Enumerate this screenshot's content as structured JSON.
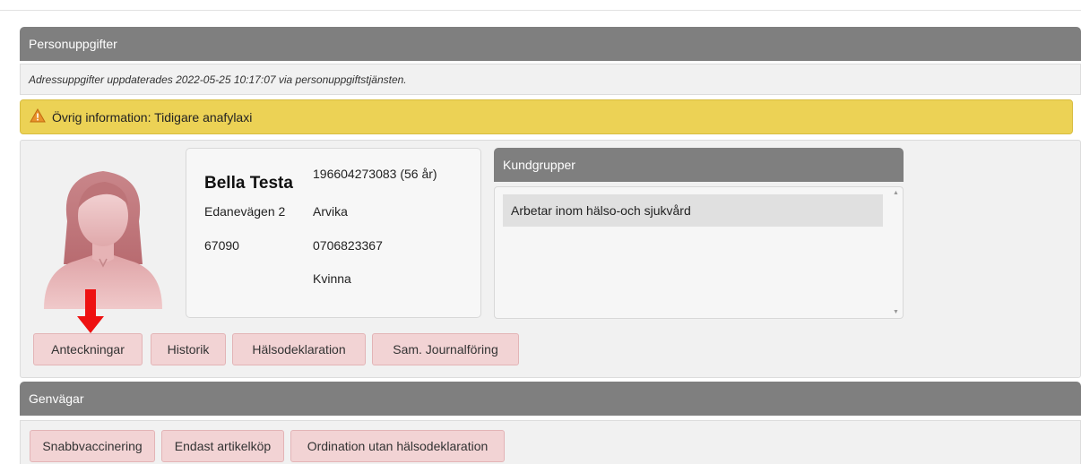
{
  "personal": {
    "section_title": "Personuppgifter",
    "address_note": "Adressuppgifter uppdaterades 2022-05-25 10:17:07 via personuppgiftstjänsten.",
    "warning_icon": "warning-triangle-icon",
    "warning_text": "Övrig information: Tidigare anafylaxi"
  },
  "person": {
    "name": "Bella Testa",
    "personal_number": "196604273083 (56 år)",
    "street": "Edanevägen 2",
    "city": "Arvika",
    "postal_code": "67090",
    "phone": "0706823367",
    "gender": "Kvinna"
  },
  "customer_groups": {
    "title": "Kundgrupper",
    "items": [
      "Arbetar inom hälso-och sjukvård"
    ]
  },
  "action_buttons": {
    "notes": "Anteckningar",
    "history": "Historik",
    "health_declaration": "Hälsodeklaration",
    "shared_journal": "Sam. Journalföring"
  },
  "shortcuts": {
    "section_title": "Genvägar",
    "quick_vaccination": "Snabbvaccinering",
    "article_only": "Endast artikelköp",
    "prescription_no_declaration": "Ordination utan hälsodeklaration"
  },
  "colors": {
    "header_bar": "#7f7f7f",
    "warning_bg": "#ecd255",
    "button_bg": "#f2d3d4",
    "highlight_arrow": "#ee1111"
  }
}
